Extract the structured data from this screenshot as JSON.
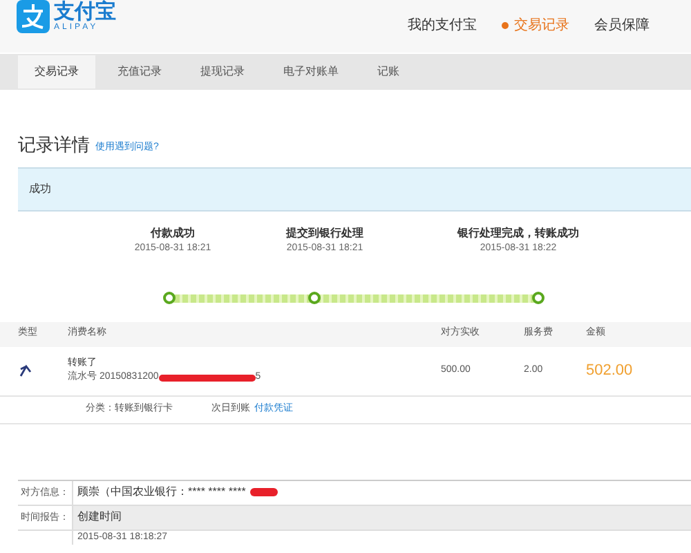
{
  "header": {
    "logo_text": "支付宝",
    "logo_subtext": "ALIPAY",
    "nav": [
      {
        "label": "我的支付宝",
        "selected": false
      },
      {
        "label": "交易记录",
        "selected": true
      },
      {
        "label": "会员保障",
        "selected": false
      }
    ]
  },
  "subnav": [
    {
      "label": "交易记录",
      "selected": true
    },
    {
      "label": "充值记录",
      "selected": false
    },
    {
      "label": "提现记录",
      "selected": false
    },
    {
      "label": "电子对账单",
      "selected": false
    },
    {
      "label": "记账",
      "selected": false
    }
  ],
  "title": "记录详情",
  "help_link": "使用遇到问题?",
  "status": "成功",
  "steps": [
    {
      "label": "付款成功",
      "time": "2015-08-31 18:21",
      "done": true
    },
    {
      "label": "提交到银行处理",
      "time": "2015-08-31 18:21",
      "done": true
    },
    {
      "label": "银行处理完成，转账成功",
      "time": "2015-08-31 18:22",
      "done": true
    }
  ],
  "table": {
    "columns": [
      "类型",
      "消费名称",
      "对方实收",
      "服务费",
      "金额"
    ],
    "row": {
      "name": "转账了",
      "serial_prefix": "流水号 20150831200",
      "serial_suffix": "5",
      "received": "500.00",
      "fee": "2.00",
      "amount": "502.00"
    },
    "detail": {
      "category": "分类：转账到银行卡",
      "arrival": "次日到账",
      "voucher_link": "付款凭证"
    }
  },
  "info": [
    {
      "label": "对方信息：",
      "value": "顾崇（中国农业银行：**** **** ****",
      "redacted": true
    },
    {
      "label": "时间报告：",
      "value": "创建时间",
      "redacted": false
    }
  ],
  "time_value": "2015-08-31 18:18:27"
}
